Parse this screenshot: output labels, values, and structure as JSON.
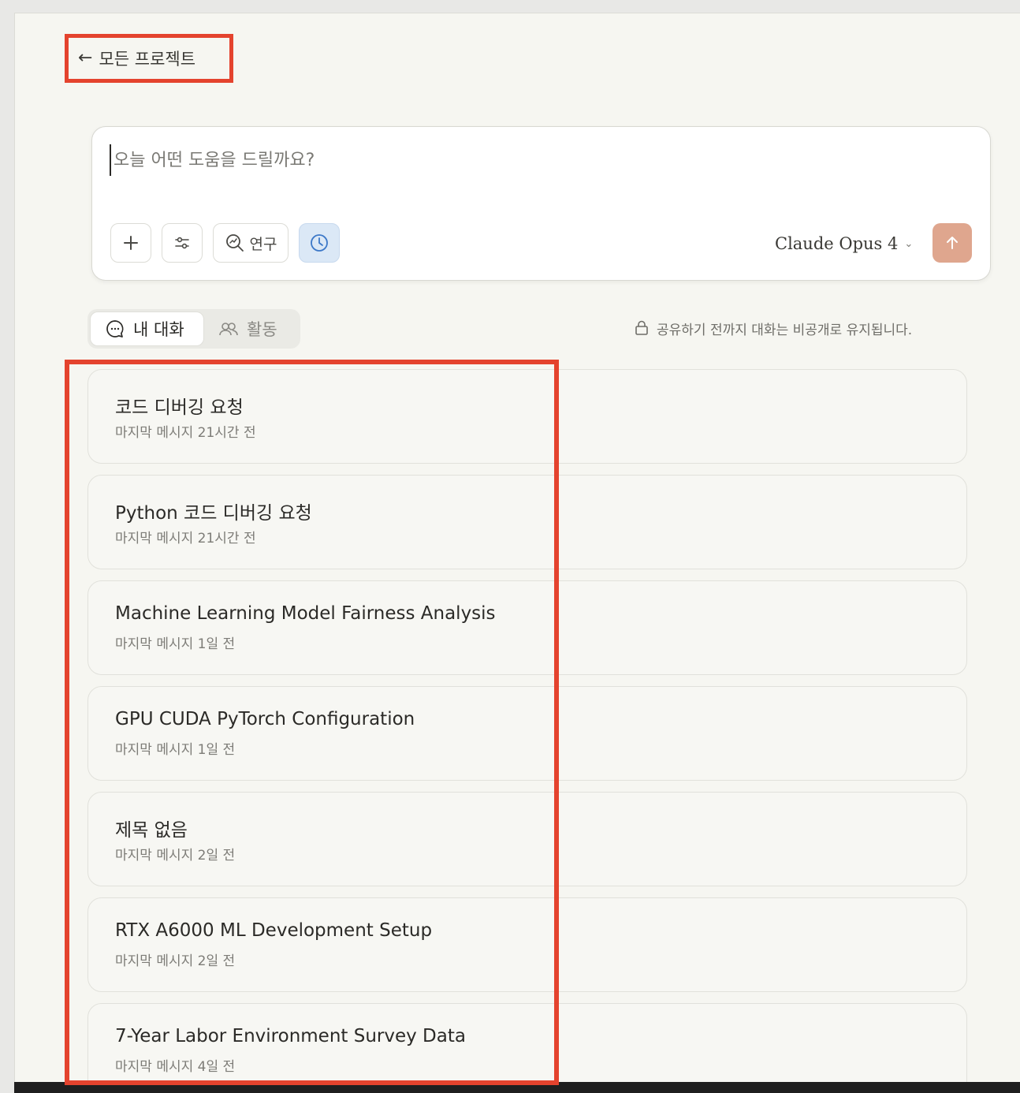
{
  "nav": {
    "back_label": "모든 프로젝트"
  },
  "composer": {
    "placeholder": "오늘 어떤 도움을 드릴까요?",
    "research_label": "연구",
    "model_label": "Claude Opus 4"
  },
  "tabs": {
    "my_conversations": "내 대화",
    "activity": "활동"
  },
  "privacy_note": "공유하기 전까지 대화는 비공개로 유지됩니다.",
  "conversations": [
    {
      "title": "코드 디버깅 요청",
      "meta": "마지막 메시지 21시간 전"
    },
    {
      "title": "Python 코드 디버깅 요청",
      "meta": "마지막 메시지 21시간 전"
    },
    {
      "title": "Machine Learning Model Fairness Analysis",
      "meta": "마지막 메시지 1일 전"
    },
    {
      "title": "GPU CUDA PyTorch Configuration",
      "meta": "마지막 메시지 1일 전"
    },
    {
      "title": "제목 없음",
      "meta": "마지막 메시지 2일 전"
    },
    {
      "title": "RTX A6000 ML Development Setup",
      "meta": "마지막 메시지 2일 전"
    },
    {
      "title": "7-Year Labor Environment Survey Data",
      "meta": "마지막 메시지 4일 전"
    }
  ],
  "colors": {
    "highlight": "#e4432e",
    "send_button": "#dfa68e",
    "active_clock_button": "#dbe8f6"
  }
}
